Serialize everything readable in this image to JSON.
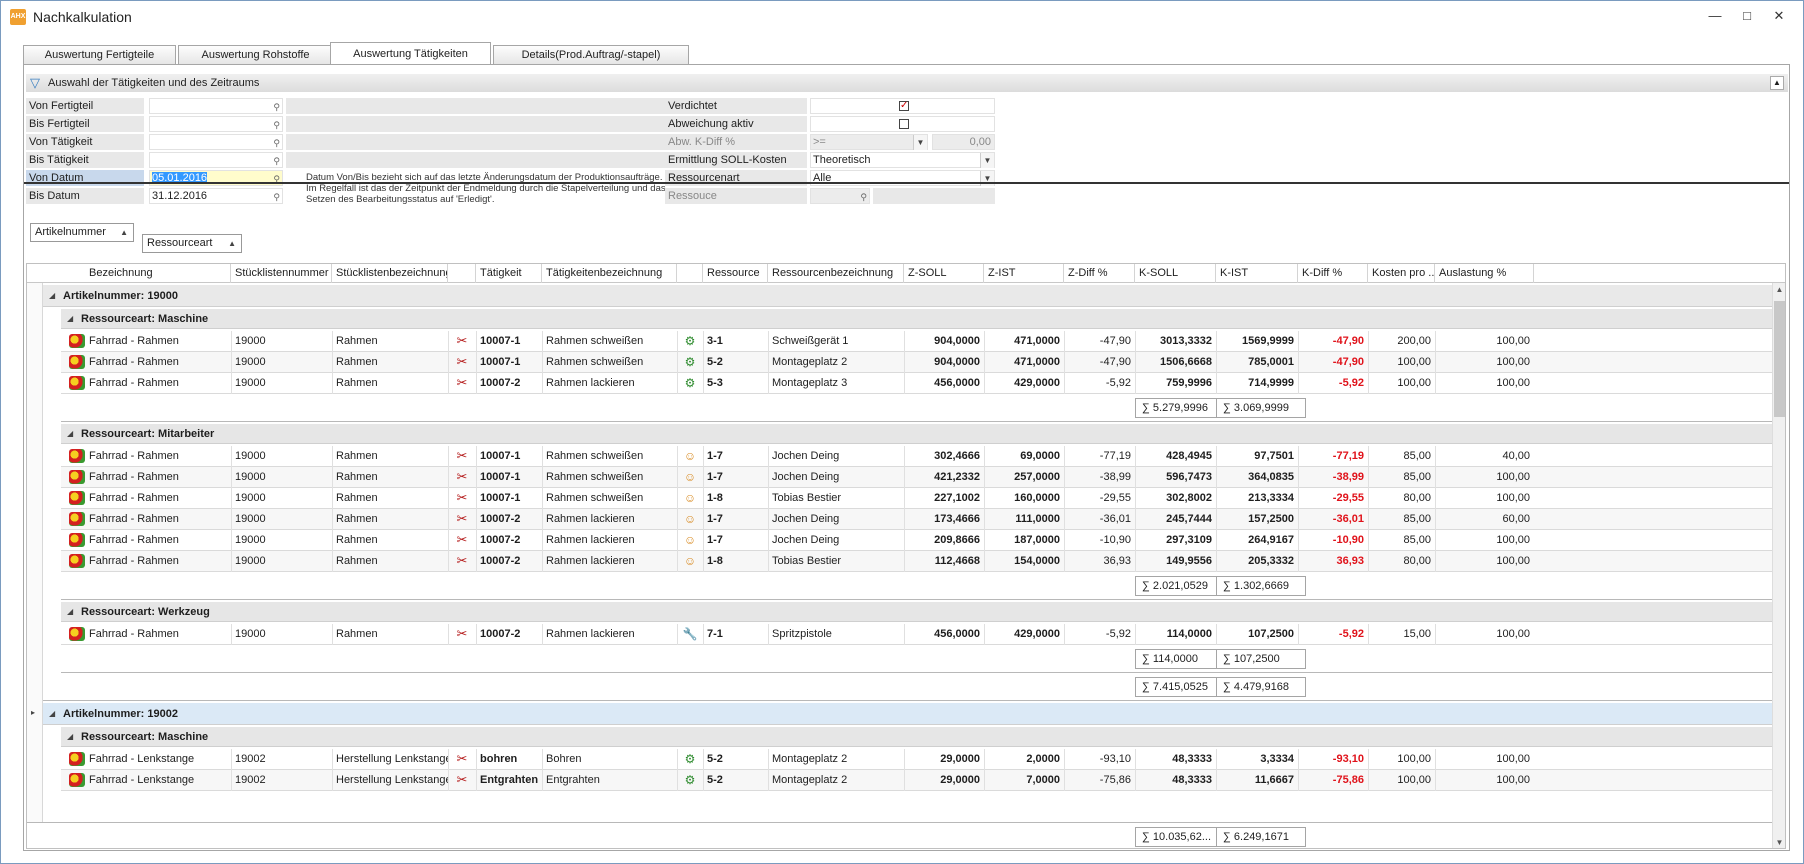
{
  "window": {
    "title": "Nachkalkulation",
    "app_icon_label": "AHX"
  },
  "tabs": [
    {
      "label": "Auswertung Fertigteile",
      "active": false
    },
    {
      "label": "Auswertung Rohstoffe",
      "active": false
    },
    {
      "label": "Auswertung Tätigkeiten",
      "active": true
    },
    {
      "label": "Details(Prod.Auftrag/-stapel)",
      "active": false
    }
  ],
  "filter": {
    "title": "Auswahl der Tätigkeiten und des Zeitraums",
    "left": [
      {
        "label": "Von Fertigteil",
        "value": ""
      },
      {
        "label": "Bis Fertigteil",
        "value": ""
      },
      {
        "label": "Von Tätigkeit",
        "value": ""
      },
      {
        "label": "Bis Tätigkeit",
        "value": ""
      },
      {
        "label": "Von Datum",
        "value": "05.01.2016"
      },
      {
        "label": "Bis Datum",
        "value": "31.12.2016"
      }
    ],
    "date_hint": "Datum Von/Bis bezieht sich auf das letzte Änderungsdatum der Produktionsaufträge. Im Regelfall ist das der Zeitpunkt der Endmeldung durch die Stapelverteilung und das Setzen des Bearbeitungsstatus auf 'Erledigt'.",
    "right": {
      "verdichtet_label": "Verdichtet",
      "verdichtet_checked": true,
      "abweichung_label": "Abweichung aktiv",
      "abweichung_checked": false,
      "abw_label": "Abw. K-Diff %",
      "abw_op": ">=",
      "abw_value": "0,00",
      "soll_label": "Ermittlung SOLL-Kosten",
      "soll_value": "Theoretisch",
      "resart_label": "Ressourcenart",
      "resart_value": "Alle",
      "ressouce_label": "Ressouce"
    }
  },
  "group_chips": [
    "Artikelnummer",
    "Ressourceart"
  ],
  "columns": [
    "Bezeichnung",
    "Stücklistennummer",
    "Stücklistenbezeichnung",
    "",
    "Tätigkeit",
    "Tätigkeitenbezeichnung",
    "",
    "Ressource",
    "Ressourcenbezeichnung",
    "Z-SOLL",
    "Z-IST",
    "Z-Diff %",
    "K-SOLL",
    "K-IST",
    "K-Diff %",
    "Kosten pro ...",
    "Auslastung %"
  ],
  "groups": [
    {
      "title": "Artikelnummer: 19000",
      "subgroups": [
        {
          "title": "Ressourceart: Maschine",
          "res_icon": "machine",
          "rows": [
            [
              "Fahrrad - Rahmen",
              "19000",
              "Rahmen",
              "10007-1",
              "Rahmen schweißen",
              "3-1",
              "Schweißgerät 1",
              "904,0000",
              "471,0000",
              "-47,90",
              "3013,3332",
              "1569,9999",
              "-47,90",
              "200,00",
              "100,00"
            ],
            [
              "Fahrrad - Rahmen",
              "19000",
              "Rahmen",
              "10007-1",
              "Rahmen schweißen",
              "5-2",
              "Montageplatz 2",
              "904,0000",
              "471,0000",
              "-47,90",
              "1506,6668",
              "785,0001",
              "-47,90",
              "100,00",
              "100,00"
            ],
            [
              "Fahrrad - Rahmen",
              "19000",
              "Rahmen",
              "10007-2",
              "Rahmen lackieren",
              "5-3",
              "Montageplatz 3",
              "456,0000",
              "429,0000",
              "-5,92",
              "759,9996",
              "714,9999",
              "-5,92",
              "100,00",
              "100,00"
            ]
          ],
          "sum_ksoll": "∑ 5.279,9996",
          "sum_kist": "∑ 3.069,9999"
        },
        {
          "title": "Ressourceart: Mitarbeiter",
          "res_icon": "person",
          "rows": [
            [
              "Fahrrad - Rahmen",
              "19000",
              "Rahmen",
              "10007-1",
              "Rahmen schweißen",
              "1-7",
              "Jochen Deing",
              "302,4666",
              "69,0000",
              "-77,19",
              "428,4945",
              "97,7501",
              "-77,19",
              "85,00",
              "40,00"
            ],
            [
              "Fahrrad - Rahmen",
              "19000",
              "Rahmen",
              "10007-1",
              "Rahmen schweißen",
              "1-7",
              "Jochen Deing",
              "421,2332",
              "257,0000",
              "-38,99",
              "596,7473",
              "364,0835",
              "-38,99",
              "85,00",
              "100,00"
            ],
            [
              "Fahrrad - Rahmen",
              "19000",
              "Rahmen",
              "10007-1",
              "Rahmen schweißen",
              "1-8",
              "Tobias Bestier",
              "227,1002",
              "160,0000",
              "-29,55",
              "302,8002",
              "213,3334",
              "-29,55",
              "80,00",
              "100,00"
            ],
            [
              "Fahrrad - Rahmen",
              "19000",
              "Rahmen",
              "10007-2",
              "Rahmen lackieren",
              "1-7",
              "Jochen Deing",
              "173,4666",
              "111,0000",
              "-36,01",
              "245,7444",
              "157,2500",
              "-36,01",
              "85,00",
              "60,00"
            ],
            [
              "Fahrrad - Rahmen",
              "19000",
              "Rahmen",
              "10007-2",
              "Rahmen lackieren",
              "1-7",
              "Jochen Deing",
              "209,8666",
              "187,0000",
              "-10,90",
              "297,3109",
              "264,9167",
              "-10,90",
              "85,00",
              "100,00"
            ],
            [
              "Fahrrad - Rahmen",
              "19000",
              "Rahmen",
              "10007-2",
              "Rahmen lackieren",
              "1-8",
              "Tobias Bestier",
              "112,4668",
              "154,0000",
              "36,93",
              "149,9556",
              "205,3332",
              "36,93",
              "80,00",
              "100,00"
            ]
          ],
          "sum_ksoll": "∑ 2.021,0529",
          "sum_kist": "∑ 1.302,6669"
        },
        {
          "title": "Ressourceart: Werkzeug",
          "res_icon": "tool",
          "rows": [
            [
              "Fahrrad - Rahmen",
              "19000",
              "Rahmen",
              "10007-2",
              "Rahmen lackieren",
              "7-1",
              "Spritzpistole",
              "456,0000",
              "429,0000",
              "-5,92",
              "114,0000",
              "107,2500",
              "-5,92",
              "15,00",
              "100,00"
            ]
          ],
          "sum_ksoll": "∑ 114,0000",
          "sum_kist": "∑ 107,2500"
        }
      ],
      "sum_ksoll": "∑ 7.415,0525",
      "sum_kist": "∑ 4.479,9168"
    },
    {
      "title": "Artikelnummer: 19002",
      "subgroups": [
        {
          "title": "Ressourceart: Maschine",
          "res_icon": "machine",
          "rows": [
            [
              "Fahrrad - Lenkstange",
              "19002",
              "Herstellung Lenkstange",
              "bohren",
              "Bohren",
              "5-2",
              "Montageplatz 2",
              "29,0000",
              "2,0000",
              "-93,10",
              "48,3333",
              "3,3334",
              "-93,10",
              "100,00",
              "100,00"
            ],
            [
              "Fahrrad - Lenkstange",
              "19002",
              "Herstellung Lenkstange",
              "Entgrahten",
              "Entgrahten",
              "5-2",
              "Montageplatz 2",
              "29,0000",
              "7,0000",
              "-75,86",
              "48,3333",
              "11,6667",
              "-75,86",
              "100,00",
              "100,00"
            ]
          ]
        }
      ]
    }
  ],
  "total": {
    "sum_ksoll": "∑ 10.035,62...",
    "sum_kist": "∑ 6.249,1671"
  }
}
